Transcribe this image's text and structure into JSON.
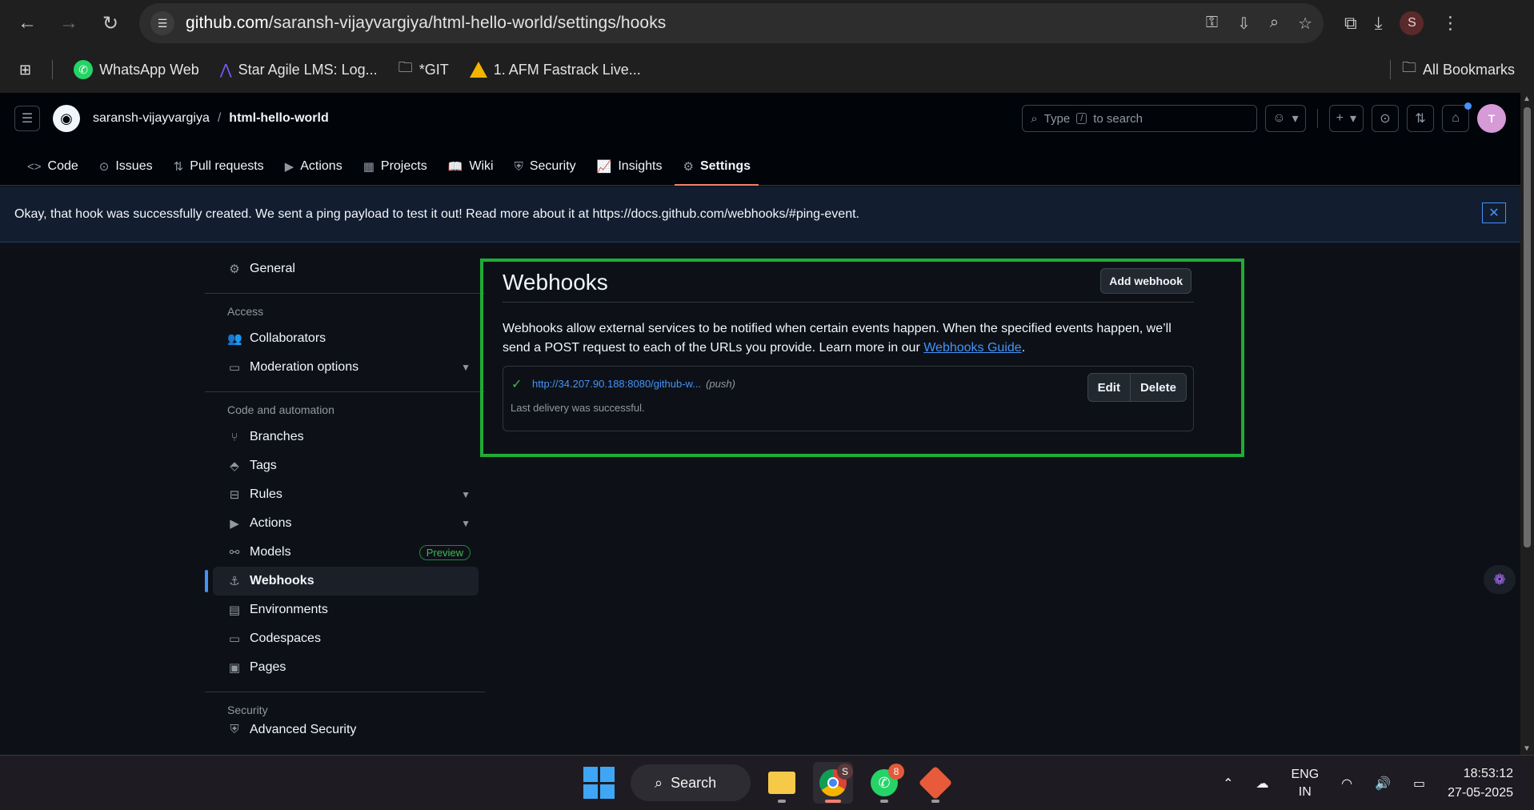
{
  "browser": {
    "url_host": "github.com",
    "url_path": "/saransh-vijayvargiya/html-hello-world/settings/hooks",
    "profile_initial": "S",
    "bookmarks": [
      {
        "label": "WhatsApp Web",
        "icon": "whatsapp-icon"
      },
      {
        "label": "Star Agile LMS: Log...",
        "icon": "star-agile-icon"
      },
      {
        "label": "*GIT",
        "icon": "folder-icon"
      },
      {
        "label": "1. AFM Fastrack Live...",
        "icon": "google-drive-icon"
      }
    ],
    "all_bookmarks": "All Bookmarks"
  },
  "header": {
    "owner": "saransh-vijayvargiya",
    "separator": "/",
    "repo": "html-hello-world",
    "search_prefix": "Type",
    "search_key": "/",
    "search_suffix": "to search",
    "plus": "+",
    "avatar_text": "T"
  },
  "tabs": [
    {
      "label": "Code",
      "icon": "<>"
    },
    {
      "label": "Issues",
      "icon": "⊙"
    },
    {
      "label": "Pull requests",
      "icon": "⇅"
    },
    {
      "label": "Actions",
      "icon": "▶"
    },
    {
      "label": "Projects",
      "icon": "▦"
    },
    {
      "label": "Wiki",
      "icon": "📖"
    },
    {
      "label": "Security",
      "icon": "⛨"
    },
    {
      "label": "Insights",
      "icon": "📈"
    },
    {
      "label": "Settings",
      "icon": "⚙"
    }
  ],
  "flash": {
    "message": "Okay, that hook was successfully created. We sent a ping payload to test it out! Read more about it at https://docs.github.com/webhooks/#ping-event.",
    "close": "✕"
  },
  "sidebar": {
    "general": "General",
    "access_heading": "Access",
    "collaborators": "Collaborators",
    "moderation": "Moderation options",
    "code_heading": "Code and automation",
    "branches": "Branches",
    "tags": "Tags",
    "rules": "Rules",
    "actions": "Actions",
    "models": "Models",
    "preview_badge": "Preview",
    "webhooks": "Webhooks",
    "environments": "Environments",
    "codespaces": "Codespaces",
    "pages": "Pages",
    "security_heading": "Security",
    "advanced_security": "Advanced Security"
  },
  "webhooks": {
    "title": "Webhooks",
    "add_button": "Add webhook",
    "description": "Webhooks allow external services to be notified when certain events happen. When the specified events happen, we’ll send a POST request to each of the URLs you provide. Learn more in our",
    "guide_link": "Webhooks Guide",
    "period": ".",
    "hook": {
      "url": "http://34.207.90.188:8080/github-w...",
      "event": "(push)",
      "status": "Last delivery was successful.",
      "edit": "Edit",
      "delete": "Delete"
    }
  },
  "taskbar": {
    "search": "Search",
    "whatsapp_badge": "8",
    "chrome_profile": "S",
    "lang_top": "ENG",
    "lang_bottom": "IN",
    "time": "18:53:12",
    "date": "27-05-2025"
  },
  "colors": {
    "highlight_border": "#1fad36",
    "accent_blue": "#4493f8",
    "active_tab_underline": "#f78166"
  }
}
